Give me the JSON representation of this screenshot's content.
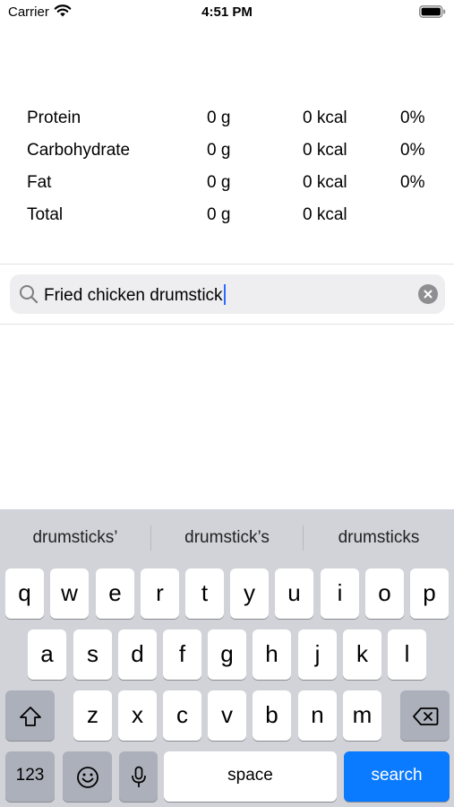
{
  "status_bar": {
    "carrier": "Carrier",
    "time": "4:51 PM"
  },
  "nutrition": {
    "rows": [
      {
        "name": "Protein",
        "grams": "0 g",
        "kcal": "0 kcal",
        "percent": "0%"
      },
      {
        "name": "Carbohydrate",
        "grams": "0 g",
        "kcal": "0 kcal",
        "percent": "0%"
      },
      {
        "name": "Fat",
        "grams": "0 g",
        "kcal": "0 kcal",
        "percent": "0%"
      },
      {
        "name": "Total",
        "grams": "0 g",
        "kcal": "0 kcal",
        "percent": ""
      }
    ]
  },
  "search": {
    "value": "Fried chicken drumstick"
  },
  "keyboard": {
    "suggestions": [
      "drumsticks’",
      "drumstick’s",
      "drumsticks"
    ],
    "row1": [
      "q",
      "w",
      "e",
      "r",
      "t",
      "y",
      "u",
      "i",
      "o",
      "p"
    ],
    "row2": [
      "a",
      "s",
      "d",
      "f",
      "g",
      "h",
      "j",
      "k",
      "l"
    ],
    "row3": [
      "z",
      "x",
      "c",
      "v",
      "b",
      "n",
      "m"
    ],
    "numbers_label": "123",
    "space_label": "space",
    "search_label": "search"
  },
  "colors": {
    "accent": "#0a7aff",
    "keyboard_bg": "#d1d3d9"
  }
}
